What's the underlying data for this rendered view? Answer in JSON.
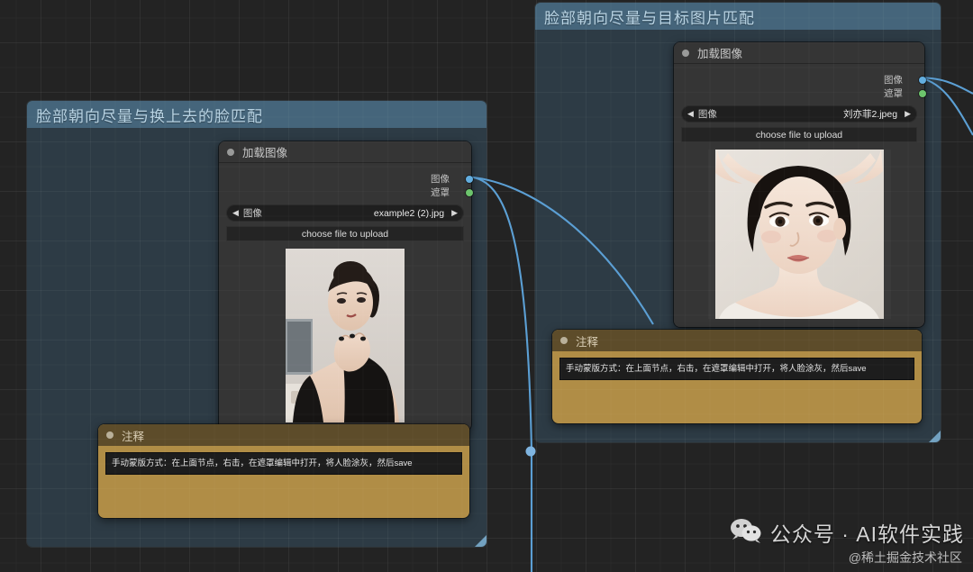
{
  "app": {
    "name": "node-graph-editor"
  },
  "groups": [
    {
      "id": "group-left",
      "title": "脸部朝向尽量与换上去的脸匹配",
      "color": "#3c5f78"
    },
    {
      "id": "group-right",
      "title": "脸部朝向尽量与目标图片匹配",
      "color": "#3c5f78"
    }
  ],
  "nodes": [
    {
      "id": "load-image-left",
      "title": "加载图像",
      "outputs": [
        {
          "label": "图像",
          "color": "#63aee0"
        },
        {
          "label": "遮罩",
          "color": "#6cc46c"
        }
      ],
      "widgets": {
        "combo_name": "图像",
        "combo_value": "example2 (2).jpg",
        "prev_arrow": "◀",
        "next_arrow": "▶",
        "upload_button": "choose file to upload"
      }
    },
    {
      "id": "load-image-right",
      "title": "加载图像",
      "outputs": [
        {
          "label": "图像",
          "color": "#63aee0"
        },
        {
          "label": "遮罩",
          "color": "#6cc46c"
        }
      ],
      "widgets": {
        "combo_name": "图像",
        "combo_value": "刘亦菲2.jpeg",
        "prev_arrow": "◀",
        "next_arrow": "▶",
        "upload_button": "choose file to upload"
      }
    }
  ],
  "notes": [
    {
      "id": "note-left",
      "title": "注释",
      "text": "手动蒙版方式：在上面节点，右击，在遮罩编辑中打开，将人脸涂灰，然后save"
    },
    {
      "id": "note-right",
      "title": "注释",
      "text": "手动蒙版方式：在上面节点，右击，在遮罩编辑中打开，将人脸涂灰，然后save"
    }
  ],
  "watermark": {
    "title": "公众号 · AI软件实践",
    "subtitle": "@稀土掘金技术社区",
    "icon": "wechat-icon"
  },
  "theme": {
    "canvas_bg": "#232323",
    "node_bg": "#353535",
    "note_bg": "#b08d46",
    "link_color": "#5b9fd4",
    "group_title_color": "#b9d4e4"
  }
}
